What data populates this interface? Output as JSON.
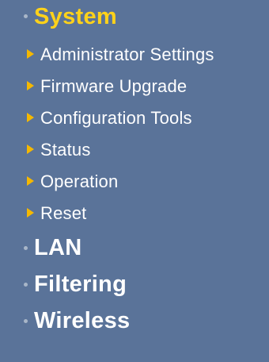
{
  "menu": {
    "system": {
      "label": "System",
      "items": [
        {
          "label": "Administrator Settings"
        },
        {
          "label": "Firmware Upgrade"
        },
        {
          "label": "Configuration Tools"
        },
        {
          "label": "Status"
        },
        {
          "label": "Operation"
        },
        {
          "label": "Reset"
        }
      ]
    },
    "lan": {
      "label": "LAN"
    },
    "filtering": {
      "label": "Filtering"
    },
    "wireless": {
      "label": "Wireless"
    }
  },
  "colors": {
    "background": "#5a7399",
    "active_section": "#ffd21a",
    "text": "#ffffff",
    "arrow": "#f5b800",
    "bullet": "#a8b6c8"
  },
  "icons": {
    "section_bullet": "dot-bullet-icon",
    "item_arrow": "triangle-right-icon"
  }
}
